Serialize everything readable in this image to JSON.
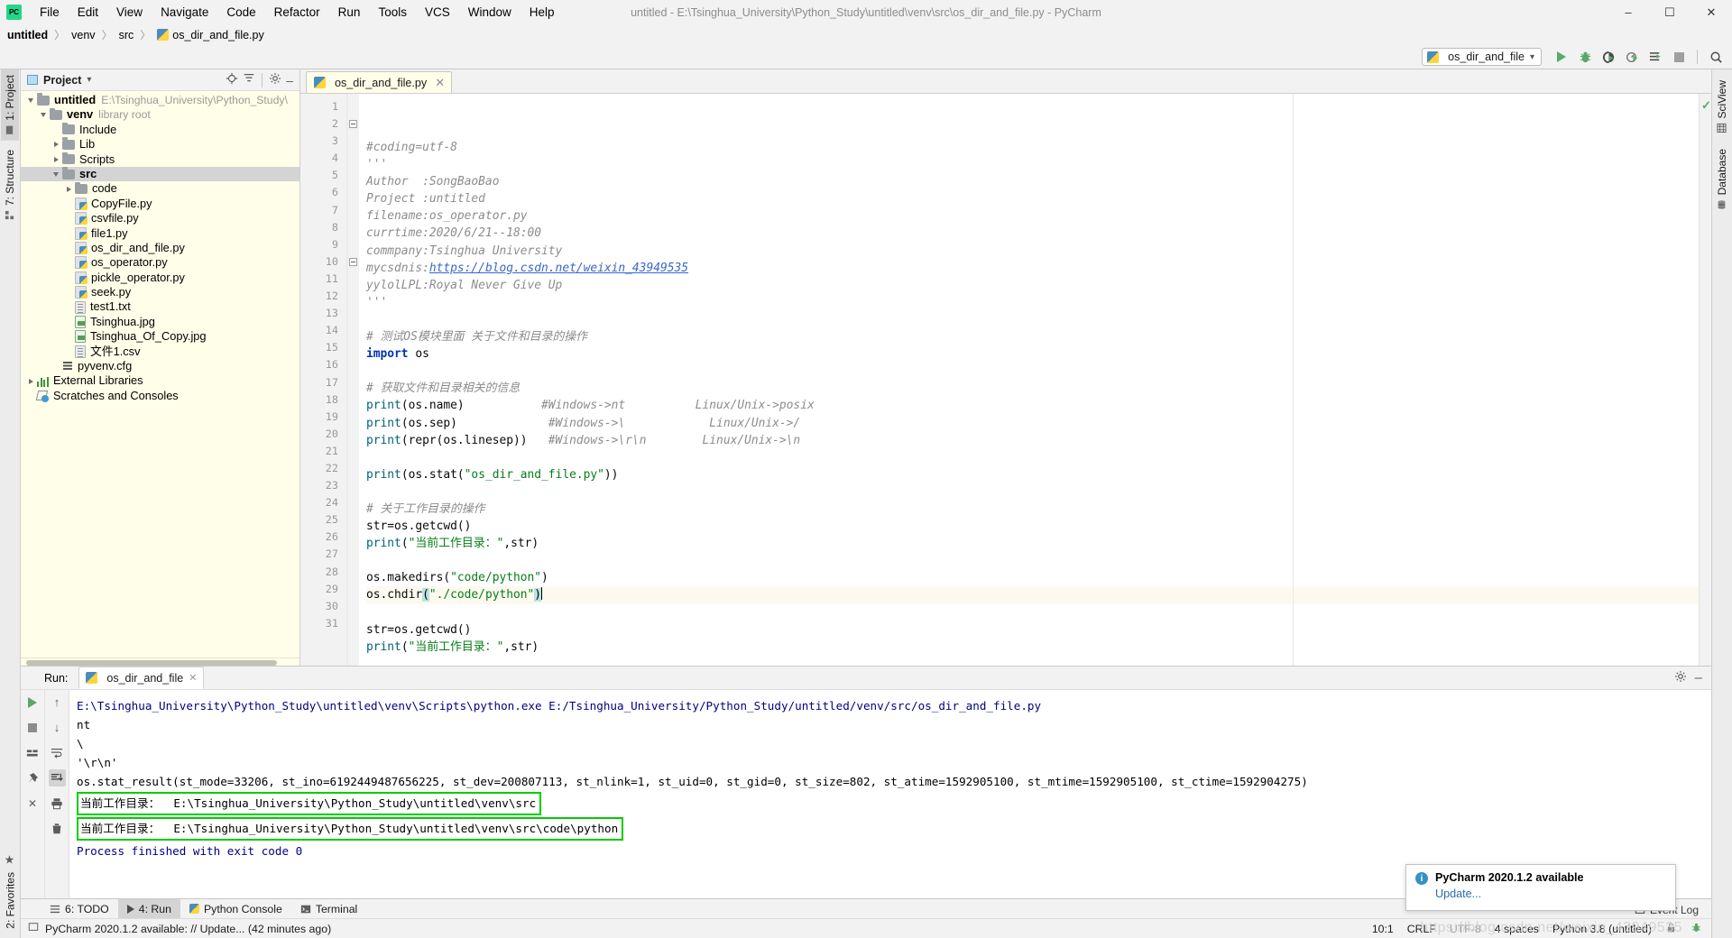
{
  "window": {
    "title": "untitled - E:\\Tsinghua_University\\Python_Study\\untitled\\venv\\src\\os_dir_and_file.py - PyCharm",
    "minimize": "–",
    "maximize": "☐",
    "close": "✕"
  },
  "menu": [
    "File",
    "Edit",
    "View",
    "Navigate",
    "Code",
    "Refactor",
    "Run",
    "Tools",
    "VCS",
    "Window",
    "Help"
  ],
  "breadcrumb": {
    "project": "untitled",
    "venv": "venv",
    "src": "src",
    "file": "os_dir_and_file.py",
    "separator": "〉"
  },
  "toolbar": {
    "run_config": "os_dir_and_file",
    "dropdown_caret": "▾",
    "icons": [
      "run-icon",
      "debug-icon",
      "run-coverage-icon",
      "profile-icon",
      "run-with-console-icon",
      "stop-icon",
      "search-everywhere-icon"
    ]
  },
  "left_strip": {
    "project_tab": "1: Project",
    "structure_tab": "7: Structure",
    "favorites_tab": "2: Favorites"
  },
  "right_strip": {
    "sciview_tab": "SciView",
    "database_tab": "Database"
  },
  "project_panel": {
    "title": "Project",
    "caret": "▾",
    "tree": [
      {
        "label": "untitled",
        "note": "E:\\Tsinghua_University\\Python_Study\\",
        "indent": 0,
        "icon": "folder",
        "arrow": "down",
        "bold": true,
        "selected": false
      },
      {
        "label": "venv",
        "note": "library root",
        "indent": 1,
        "icon": "folder",
        "arrow": "down",
        "bold": true,
        "selected": false
      },
      {
        "label": "Include",
        "note": "",
        "indent": 2,
        "icon": "folder",
        "arrow": "none",
        "bold": false,
        "selected": false
      },
      {
        "label": "Lib",
        "note": "",
        "indent": 2,
        "icon": "folder",
        "arrow": "right",
        "bold": false,
        "selected": false
      },
      {
        "label": "Scripts",
        "note": "",
        "indent": 2,
        "icon": "folder",
        "arrow": "right",
        "bold": false,
        "selected": false
      },
      {
        "label": "src",
        "note": "",
        "indent": 2,
        "icon": "folder",
        "arrow": "down",
        "bold": true,
        "selected": true
      },
      {
        "label": "code",
        "note": "",
        "indent": 3,
        "icon": "folder",
        "arrow": "right",
        "bold": false,
        "selected": false
      },
      {
        "label": "CopyFile.py",
        "note": "",
        "indent": 3,
        "icon": "python",
        "arrow": "none",
        "bold": false,
        "selected": false
      },
      {
        "label": "csvfile.py",
        "note": "",
        "indent": 3,
        "icon": "python",
        "arrow": "none",
        "bold": false,
        "selected": false
      },
      {
        "label": "file1.py",
        "note": "",
        "indent": 3,
        "icon": "python",
        "arrow": "none",
        "bold": false,
        "selected": false
      },
      {
        "label": "os_dir_and_file.py",
        "note": "",
        "indent": 3,
        "icon": "python",
        "arrow": "none",
        "bold": false,
        "selected": false
      },
      {
        "label": "os_operator.py",
        "note": "",
        "indent": 3,
        "icon": "python",
        "arrow": "none",
        "bold": false,
        "selected": false
      },
      {
        "label": "pickle_operator.py",
        "note": "",
        "indent": 3,
        "icon": "python",
        "arrow": "none",
        "bold": false,
        "selected": false
      },
      {
        "label": "seek.py",
        "note": "",
        "indent": 3,
        "icon": "python",
        "arrow": "none",
        "bold": false,
        "selected": false
      },
      {
        "label": "test1.txt",
        "note": "",
        "indent": 3,
        "icon": "text",
        "arrow": "none",
        "bold": false,
        "selected": false
      },
      {
        "label": "Tsinghua.jpg",
        "note": "",
        "indent": 3,
        "icon": "image",
        "arrow": "none",
        "bold": false,
        "selected": false
      },
      {
        "label": "Tsinghua_Of_Copy.jpg",
        "note": "",
        "indent": 3,
        "icon": "image",
        "arrow": "none",
        "bold": false,
        "selected": false
      },
      {
        "label": "文件1.csv",
        "note": "",
        "indent": 3,
        "icon": "text",
        "arrow": "none",
        "bold": false,
        "selected": false
      },
      {
        "label": "pyvenv.cfg",
        "note": "",
        "indent": 2,
        "icon": "config",
        "arrow": "none",
        "bold": false,
        "selected": false
      },
      {
        "label": "External Libraries",
        "note": "",
        "indent": 0,
        "icon": "library",
        "arrow": "right",
        "bold": false,
        "selected": false
      },
      {
        "label": "Scratches and Consoles",
        "note": "",
        "indent": 0,
        "icon": "scratch",
        "arrow": "none",
        "bold": false,
        "selected": false
      }
    ]
  },
  "editor": {
    "tab_label": "os_dir_and_file.py",
    "tab_close": "✕",
    "lines": [
      {
        "n": 1,
        "segs": [
          {
            "t": "#coding=utf-8",
            "c": "com"
          }
        ]
      },
      {
        "n": 2,
        "segs": [
          {
            "t": "'''",
            "c": "com"
          }
        ],
        "fold": "open"
      },
      {
        "n": 3,
        "segs": [
          {
            "t": "Author  :SongBaoBao",
            "c": "com"
          }
        ]
      },
      {
        "n": 4,
        "segs": [
          {
            "t": "Project :untitled",
            "c": "com"
          }
        ]
      },
      {
        "n": 5,
        "segs": [
          {
            "t": "filename:os_operator.py",
            "c": "com"
          }
        ]
      },
      {
        "n": 6,
        "segs": [
          {
            "t": "currtime:2020/6/21--18:00",
            "c": "com"
          }
        ]
      },
      {
        "n": 7,
        "segs": [
          {
            "t": "commpany:Tsinghua University",
            "c": "com"
          }
        ]
      },
      {
        "n": 8,
        "segs": [
          {
            "t": "mycsdnis:",
            "c": "com"
          },
          {
            "t": "https://blog.csdn.net/weixin_43949535",
            "c": "lnk"
          }
        ]
      },
      {
        "n": 9,
        "segs": [
          {
            "t": "yylolLPL:Royal Never Give Up",
            "c": "com"
          }
        ]
      },
      {
        "n": 10,
        "segs": [
          {
            "t": "'''",
            "c": "com"
          }
        ],
        "fold": "close"
      },
      {
        "n": 11,
        "segs": []
      },
      {
        "n": 12,
        "segs": [
          {
            "t": "# 测试OS模块里面 关于文件和目录的操作",
            "c": "com-cn"
          }
        ]
      },
      {
        "n": 13,
        "segs": [
          {
            "t": "import",
            "c": "kw"
          },
          {
            "t": " os",
            "c": "plain"
          }
        ]
      },
      {
        "n": 14,
        "segs": []
      },
      {
        "n": 15,
        "segs": [
          {
            "t": "# 获取文件和目录相关的信息",
            "c": "com-cn"
          }
        ]
      },
      {
        "n": 16,
        "segs": [
          {
            "t": "print",
            "c": "fn"
          },
          {
            "t": "(os.name)",
            "c": "plain"
          },
          {
            "t": "           #Windows->nt          Linux/Unix->posix",
            "c": "com"
          }
        ]
      },
      {
        "n": 17,
        "segs": [
          {
            "t": "print",
            "c": "fn"
          },
          {
            "t": "(os.sep)",
            "c": "plain"
          },
          {
            "t": "             #Windows->\\            Linux/Unix->/",
            "c": "com"
          }
        ]
      },
      {
        "n": 18,
        "segs": [
          {
            "t": "print",
            "c": "fn"
          },
          {
            "t": "(repr(os.linesep))",
            "c": "plain"
          },
          {
            "t": "   #Windows->\\r\\n        Linux/Unix->\\n",
            "c": "com"
          }
        ]
      },
      {
        "n": 19,
        "segs": []
      },
      {
        "n": 20,
        "segs": [
          {
            "t": "print",
            "c": "fn"
          },
          {
            "t": "(os.stat(",
            "c": "plain"
          },
          {
            "t": "\"os_dir_and_file.py\"",
            "c": "str"
          },
          {
            "t": "))",
            "c": "plain"
          }
        ]
      },
      {
        "n": 21,
        "segs": []
      },
      {
        "n": 22,
        "segs": [
          {
            "t": "# 关于工作目录的操作",
            "c": "com-cn"
          }
        ]
      },
      {
        "n": 23,
        "segs": [
          {
            "t": "str=os.getcwd()",
            "c": "plain"
          }
        ]
      },
      {
        "n": 24,
        "segs": [
          {
            "t": "print",
            "c": "fn"
          },
          {
            "t": "(",
            "c": "plain"
          },
          {
            "t": "\"当前工作目录：\"",
            "c": "str"
          },
          {
            "t": ",str)",
            "c": "plain"
          }
        ]
      },
      {
        "n": 25,
        "segs": []
      },
      {
        "n": 26,
        "segs": [
          {
            "t": "os.makedirs(",
            "c": "plain"
          },
          {
            "t": "\"code/python\"",
            "c": "str"
          },
          {
            "t": ")",
            "c": "plain"
          }
        ]
      },
      {
        "n": 27,
        "segs": [
          {
            "t": "os.chdir",
            "c": "plain"
          },
          {
            "t": "(",
            "c": "selbr"
          },
          {
            "t": "\"./code/python\"",
            "c": "str"
          },
          {
            "t": ")",
            "c": "selbr"
          }
        ],
        "hl": true
      },
      {
        "n": 28,
        "segs": []
      },
      {
        "n": 29,
        "segs": [
          {
            "t": "str=os.getcwd()",
            "c": "plain"
          }
        ]
      },
      {
        "n": 30,
        "segs": [
          {
            "t": "print",
            "c": "fn"
          },
          {
            "t": "(",
            "c": "plain"
          },
          {
            "t": "\"当前工作目录：\"",
            "c": "str"
          },
          {
            "t": ",str)",
            "c": "plain"
          }
        ]
      },
      {
        "n": 31,
        "segs": []
      }
    ]
  },
  "run_panel": {
    "label": "Run:",
    "tab_label": "os_dir_and_file",
    "tab_close": "✕",
    "settings_icon": "gear-icon",
    "minimize_icon": "minimize-icon",
    "console_lines": [
      {
        "text": "E:\\Tsinghua_University\\Python_Study\\untitled\\venv\\Scripts\\python.exe E:/Tsinghua_University/Python_Study/untitled/venv/src/os_dir_and_file.py",
        "style": "blue",
        "boxed": false
      },
      {
        "text": "nt",
        "style": "black",
        "boxed": false
      },
      {
        "text": "\\",
        "style": "black",
        "boxed": false
      },
      {
        "text": "'\\r\\n'",
        "style": "black",
        "boxed": false
      },
      {
        "text": "os.stat_result(st_mode=33206, st_ino=6192449487656225, st_dev=200807113, st_nlink=1, st_uid=0, st_gid=0, st_size=802, st_atime=1592905100, st_mtime=1592905100, st_ctime=1592904275)",
        "style": "black",
        "boxed": false
      },
      {
        "text": "当前工作目录：  E:\\Tsinghua_University\\Python_Study\\untitled\\venv\\src",
        "style": "black",
        "boxed": true
      },
      {
        "text": "当前工作目录：  E:\\Tsinghua_University\\Python_Study\\untitled\\venv\\src\\code\\python",
        "style": "black",
        "boxed": true
      },
      {
        "text": "",
        "style": "black",
        "boxed": false
      },
      {
        "text": "Process finished with exit code 0",
        "style": "blue",
        "boxed": false
      }
    ]
  },
  "bottom_tabs": [
    {
      "label": "6: TODO",
      "icon": "todo-icon",
      "selected": false
    },
    {
      "label": "4: Run",
      "icon": "run-icon",
      "selected": true
    },
    {
      "label": "Python Console",
      "icon": "python-icon",
      "selected": false
    },
    {
      "label": "Terminal",
      "icon": "terminal-icon",
      "selected": false
    }
  ],
  "statusbar": {
    "message": "PyCharm 2020.1.2 available: // Update... (42 minutes ago)",
    "event_log": "Event Log",
    "caret_pos": "10:1",
    "line_sep": "CRLF",
    "encoding": "UTF-8",
    "indent": "4 spaces",
    "interpreter": "Python 3.8 (untitled)",
    "lock_icon": "lock-icon",
    "bug_icon": "bug-icon"
  },
  "notification": {
    "title": "PyCharm 2020.1.2 available",
    "link": "Update...",
    "icon": "info-icon"
  },
  "watermark": "https://blog.csdn.net/weixin_43949535"
}
